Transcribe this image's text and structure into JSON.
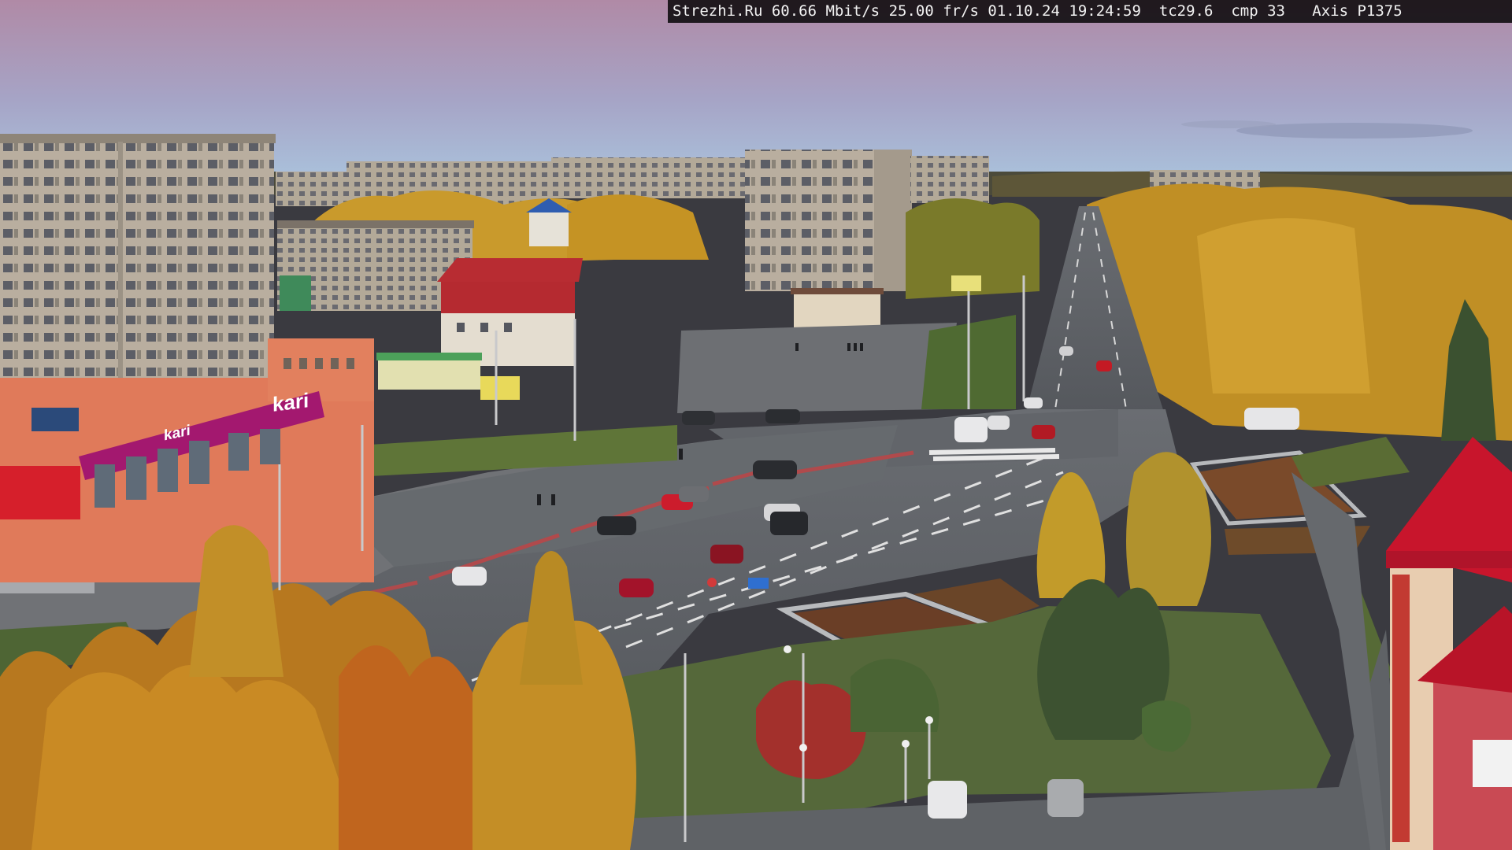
{
  "camera_overlay": {
    "site": "Strezhi.Ru",
    "bitrate": "60.66 Mbit/s",
    "framerate": "25.00 fr/s",
    "date": "01.10.24",
    "time": "19:24:59",
    "tc": "tc29.6",
    "cmp": "cmp 33",
    "camera_model": "Axis P1375"
  },
  "signage": {
    "store_sign_main": "kari",
    "store_sign_secondary": "kari"
  },
  "colors": {
    "sky_top": "#b38aa8",
    "sky_bottom": "#a9bcd8",
    "road": "#5a5d62",
    "plaza": "#6a6c70",
    "grass": "#5b6d35",
    "foliage_yellow": "#c99a2c",
    "foliage_orange": "#b86a22",
    "store_banner": "#a0186e",
    "store_facade": "#e0785a",
    "roof_red": "#c8152c"
  }
}
